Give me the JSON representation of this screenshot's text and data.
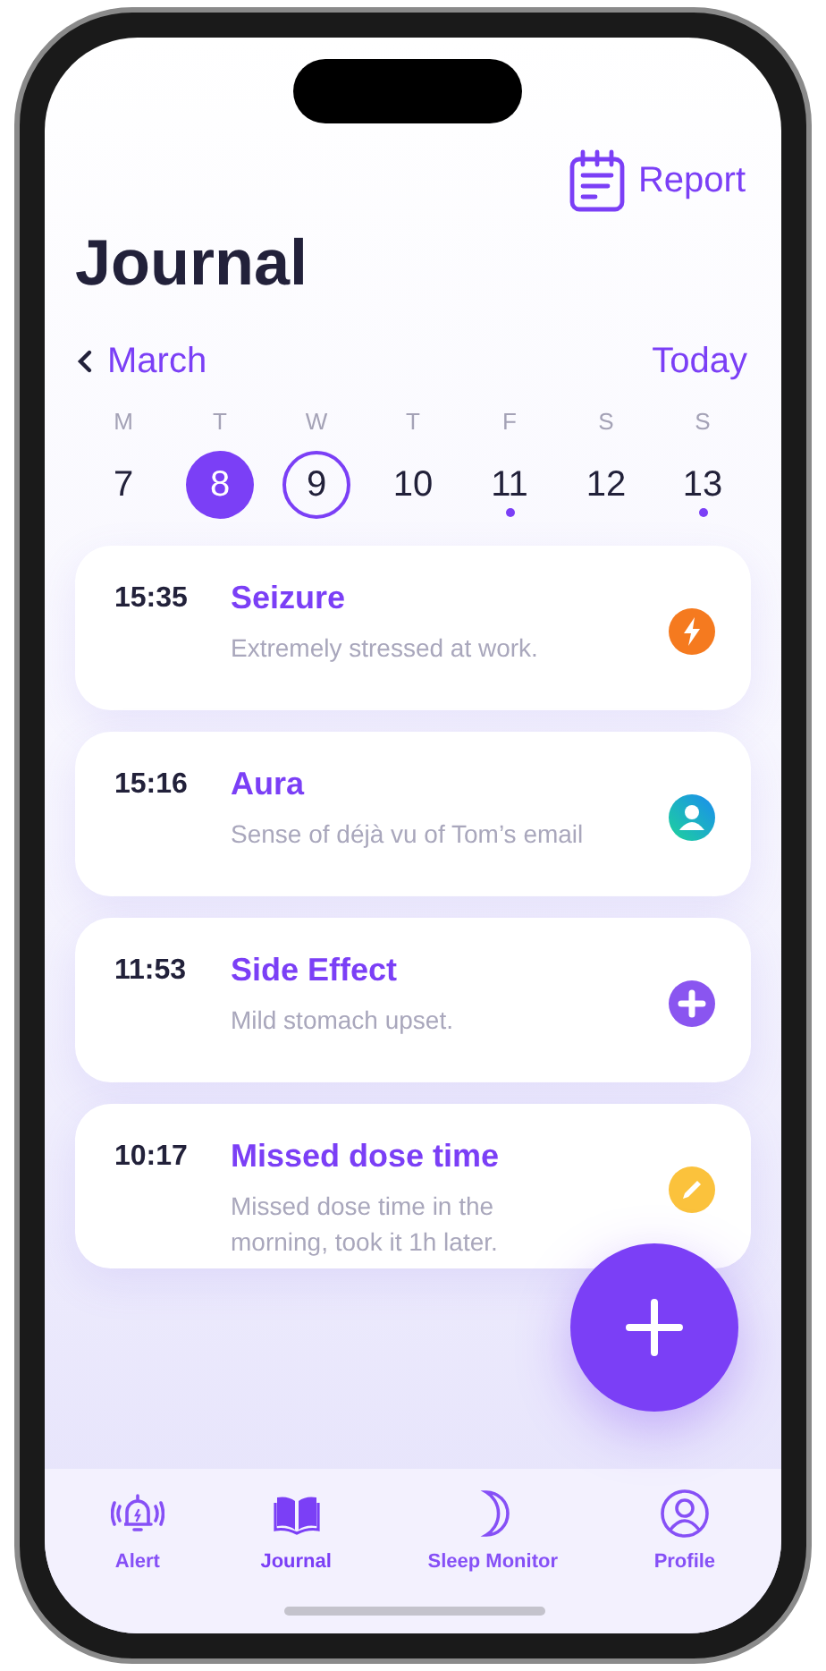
{
  "header": {
    "report_label": "Report",
    "title": "Journal"
  },
  "month_nav": {
    "month": "March",
    "today_label": "Today"
  },
  "days": [
    {
      "weekday": "M",
      "date": "7",
      "selected": false,
      "today": false,
      "has_entry": false
    },
    {
      "weekday": "T",
      "date": "8",
      "selected": true,
      "today": false,
      "has_entry": false
    },
    {
      "weekday": "W",
      "date": "9",
      "selected": false,
      "today": true,
      "has_entry": false
    },
    {
      "weekday": "T",
      "date": "10",
      "selected": false,
      "today": false,
      "has_entry": false
    },
    {
      "weekday": "F",
      "date": "11",
      "selected": false,
      "today": false,
      "has_entry": true
    },
    {
      "weekday": "S",
      "date": "12",
      "selected": false,
      "today": false,
      "has_entry": false
    },
    {
      "weekday": "S",
      "date": "13",
      "selected": false,
      "today": false,
      "has_entry": true
    }
  ],
  "entries": [
    {
      "time": "15:35",
      "title": "Seizure",
      "note": "Extremely stressed at work.",
      "kind": "seizure"
    },
    {
      "time": "15:16",
      "title": "Aura",
      "note": "Sense of déjà vu of Tom’s email",
      "kind": "aura"
    },
    {
      "time": "11:53",
      "title": "Side Effect",
      "note": "Mild stomach upset.",
      "kind": "side_effect"
    },
    {
      "time": "10:17",
      "title": "Missed dose time",
      "note": "Missed dose time in the morning, took it 1h later.",
      "kind": "missed_dose"
    }
  ],
  "tabs": [
    {
      "label": "Alert",
      "kind": "alert",
      "selected": false
    },
    {
      "label": "Journal",
      "kind": "journal",
      "selected": true
    },
    {
      "label": "Sleep Monitor",
      "kind": "sleep",
      "selected": false
    },
    {
      "label": "Profile",
      "kind": "profile",
      "selected": false
    }
  ]
}
